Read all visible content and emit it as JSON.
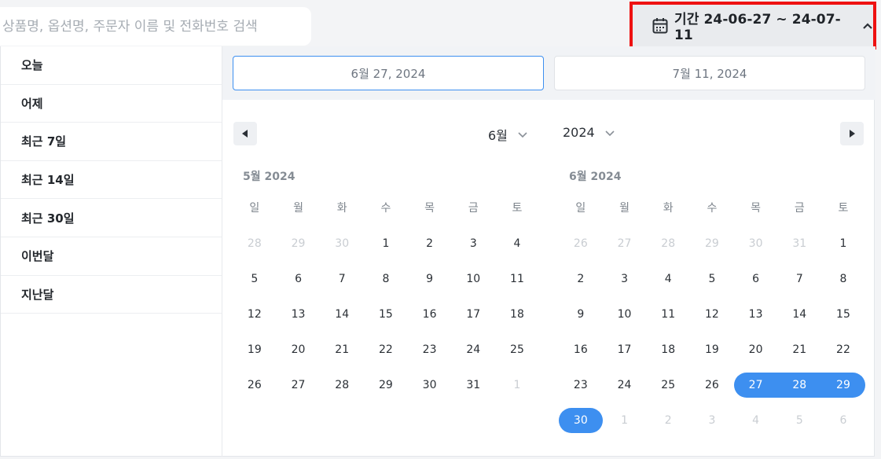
{
  "search": {
    "placeholder": "상품명, 옵션명, 주문자 이름 및 전화번호 검색"
  },
  "period_button": {
    "label": "기간 24-06-27 ~ 24-07-11",
    "icon": "calendar-icon",
    "chevron": "chevron-up-icon"
  },
  "presets": [
    "오늘",
    "어제",
    "최근 7일",
    "최근 14일",
    "최근 30일",
    "이번달",
    "지난달"
  ],
  "date_inputs": {
    "start": "6월 27, 2024",
    "end": "7월 11, 2024"
  },
  "navigation": {
    "month_select": "6월",
    "year_select": "2024",
    "prev_icon": "triangle-left-icon",
    "next_icon": "triangle-right-icon"
  },
  "weekdays": [
    "일",
    "월",
    "화",
    "수",
    "목",
    "금",
    "토"
  ],
  "calendars": [
    {
      "title": "5월 2024",
      "weeks": [
        [
          {
            "d": "28",
            "o": true
          },
          {
            "d": "29",
            "o": true
          },
          {
            "d": "30",
            "o": true
          },
          {
            "d": "1"
          },
          {
            "d": "2"
          },
          {
            "d": "3"
          },
          {
            "d": "4"
          }
        ],
        [
          {
            "d": "5"
          },
          {
            "d": "6"
          },
          {
            "d": "7"
          },
          {
            "d": "8"
          },
          {
            "d": "9"
          },
          {
            "d": "10"
          },
          {
            "d": "11"
          }
        ],
        [
          {
            "d": "12"
          },
          {
            "d": "13"
          },
          {
            "d": "14"
          },
          {
            "d": "15"
          },
          {
            "d": "16"
          },
          {
            "d": "17"
          },
          {
            "d": "18"
          }
        ],
        [
          {
            "d": "19"
          },
          {
            "d": "20"
          },
          {
            "d": "21"
          },
          {
            "d": "22"
          },
          {
            "d": "23"
          },
          {
            "d": "24"
          },
          {
            "d": "25"
          }
        ],
        [
          {
            "d": "26"
          },
          {
            "d": "27"
          },
          {
            "d": "28"
          },
          {
            "d": "29"
          },
          {
            "d": "30"
          },
          {
            "d": "31"
          },
          {
            "d": "1",
            "o": true
          }
        ]
      ]
    },
    {
      "title": "6월 2024",
      "weeks": [
        [
          {
            "d": "26",
            "o": true
          },
          {
            "d": "27",
            "o": true
          },
          {
            "d": "28",
            "o": true
          },
          {
            "d": "29",
            "o": true
          },
          {
            "d": "30",
            "o": true
          },
          {
            "d": "31",
            "o": true
          },
          {
            "d": "1"
          }
        ],
        [
          {
            "d": "2"
          },
          {
            "d": "3"
          },
          {
            "d": "4"
          },
          {
            "d": "5"
          },
          {
            "d": "6"
          },
          {
            "d": "7"
          },
          {
            "d": "8"
          }
        ],
        [
          {
            "d": "9"
          },
          {
            "d": "10"
          },
          {
            "d": "11"
          },
          {
            "d": "12"
          },
          {
            "d": "13"
          },
          {
            "d": "14"
          },
          {
            "d": "15"
          }
        ],
        [
          {
            "d": "16"
          },
          {
            "d": "17"
          },
          {
            "d": "18"
          },
          {
            "d": "19"
          },
          {
            "d": "20"
          },
          {
            "d": "21"
          },
          {
            "d": "22"
          }
        ],
        [
          {
            "d": "23"
          },
          {
            "d": "24"
          },
          {
            "d": "25"
          },
          {
            "d": "26"
          },
          {
            "d": "27",
            "s": "start"
          },
          {
            "d": "28",
            "s": "mid"
          },
          {
            "d": "29",
            "s": "end"
          }
        ],
        [
          {
            "d": "30",
            "s": "single"
          },
          {
            "d": "1",
            "o": true
          },
          {
            "d": "2",
            "o": true
          },
          {
            "d": "3",
            "o": true
          },
          {
            "d": "4",
            "o": true
          },
          {
            "d": "5",
            "o": true
          },
          {
            "d": "6",
            "o": true
          }
        ]
      ]
    }
  ],
  "colors": {
    "accent": "#3d8ff0",
    "highlight_border": "#ee1111",
    "muted_text": "#c9cdd2"
  }
}
